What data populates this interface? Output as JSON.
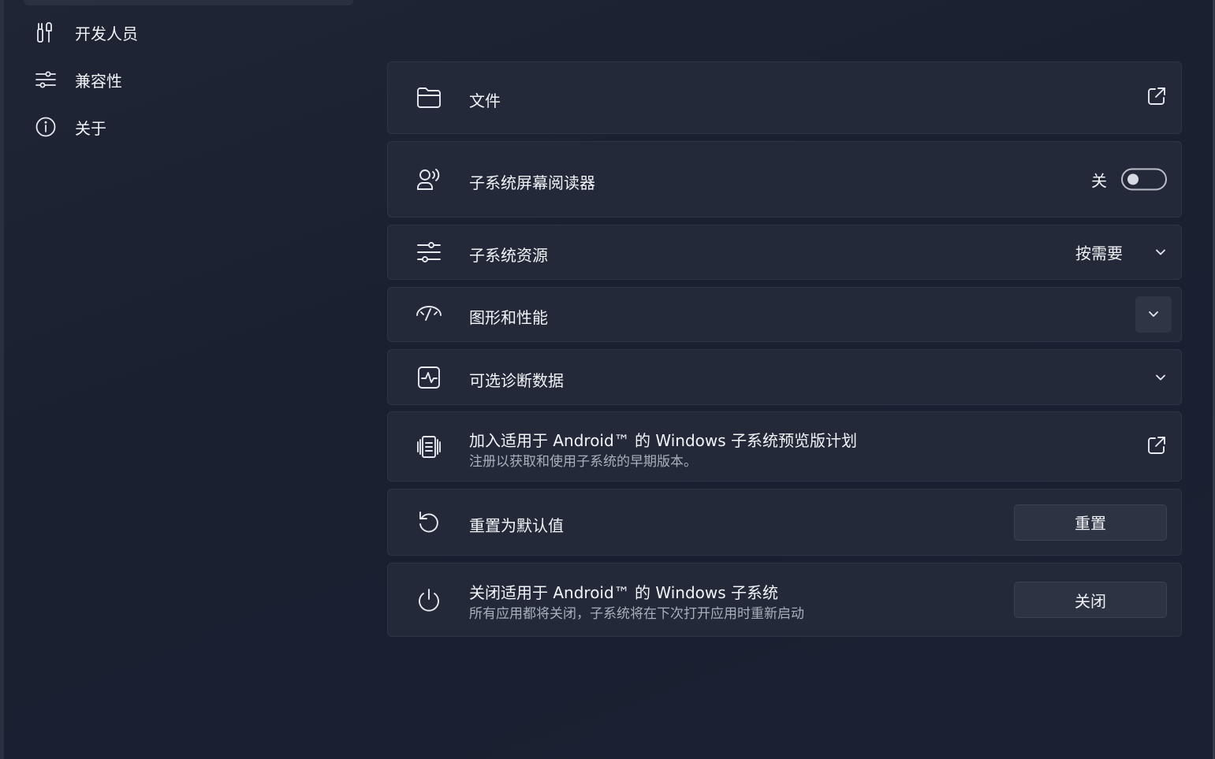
{
  "sidebar": {
    "items": [
      {
        "label": "开发人员",
        "icon": "developer-tools-icon"
      },
      {
        "label": "兼容性",
        "icon": "sliders-icon"
      },
      {
        "label": "关于",
        "icon": "info-icon"
      }
    ]
  },
  "settings": {
    "files": {
      "title": "文件",
      "icon": "folder-icon",
      "action_icon": "external-link-icon"
    },
    "screen_reader": {
      "title": "子系统屏幕阅读器",
      "icon": "screen-reader-icon",
      "state": "关",
      "on": false
    },
    "resources": {
      "title": "子系统资源",
      "icon": "sliders-icon",
      "value": "按需要"
    },
    "graphics": {
      "title": "图形和性能",
      "icon": "graphics-performance-icon"
    },
    "diagnostics": {
      "title": "可选诊断数据",
      "icon": "diagnostics-icon"
    },
    "preview": {
      "title": "加入适用于 Android™ 的 Windows 子系统预览版计划",
      "subtitle": "注册以获取和使用子系统的早期版本。",
      "icon": "preview-program-icon",
      "action_icon": "external-link-icon"
    },
    "reset": {
      "title": "重置为默认值",
      "icon": "reset-icon",
      "button": "重置"
    },
    "shutdown": {
      "title": "关闭适用于 Android™ 的 Windows 子系统",
      "subtitle": "所有应用都将关闭，子系统将在下次打开应用时重新启动",
      "icon": "power-icon",
      "button": "关闭"
    }
  },
  "colors": {
    "background": "#1c2130",
    "card": "#232938",
    "text": "#f2f4f8",
    "subtext": "#a9afbb"
  }
}
